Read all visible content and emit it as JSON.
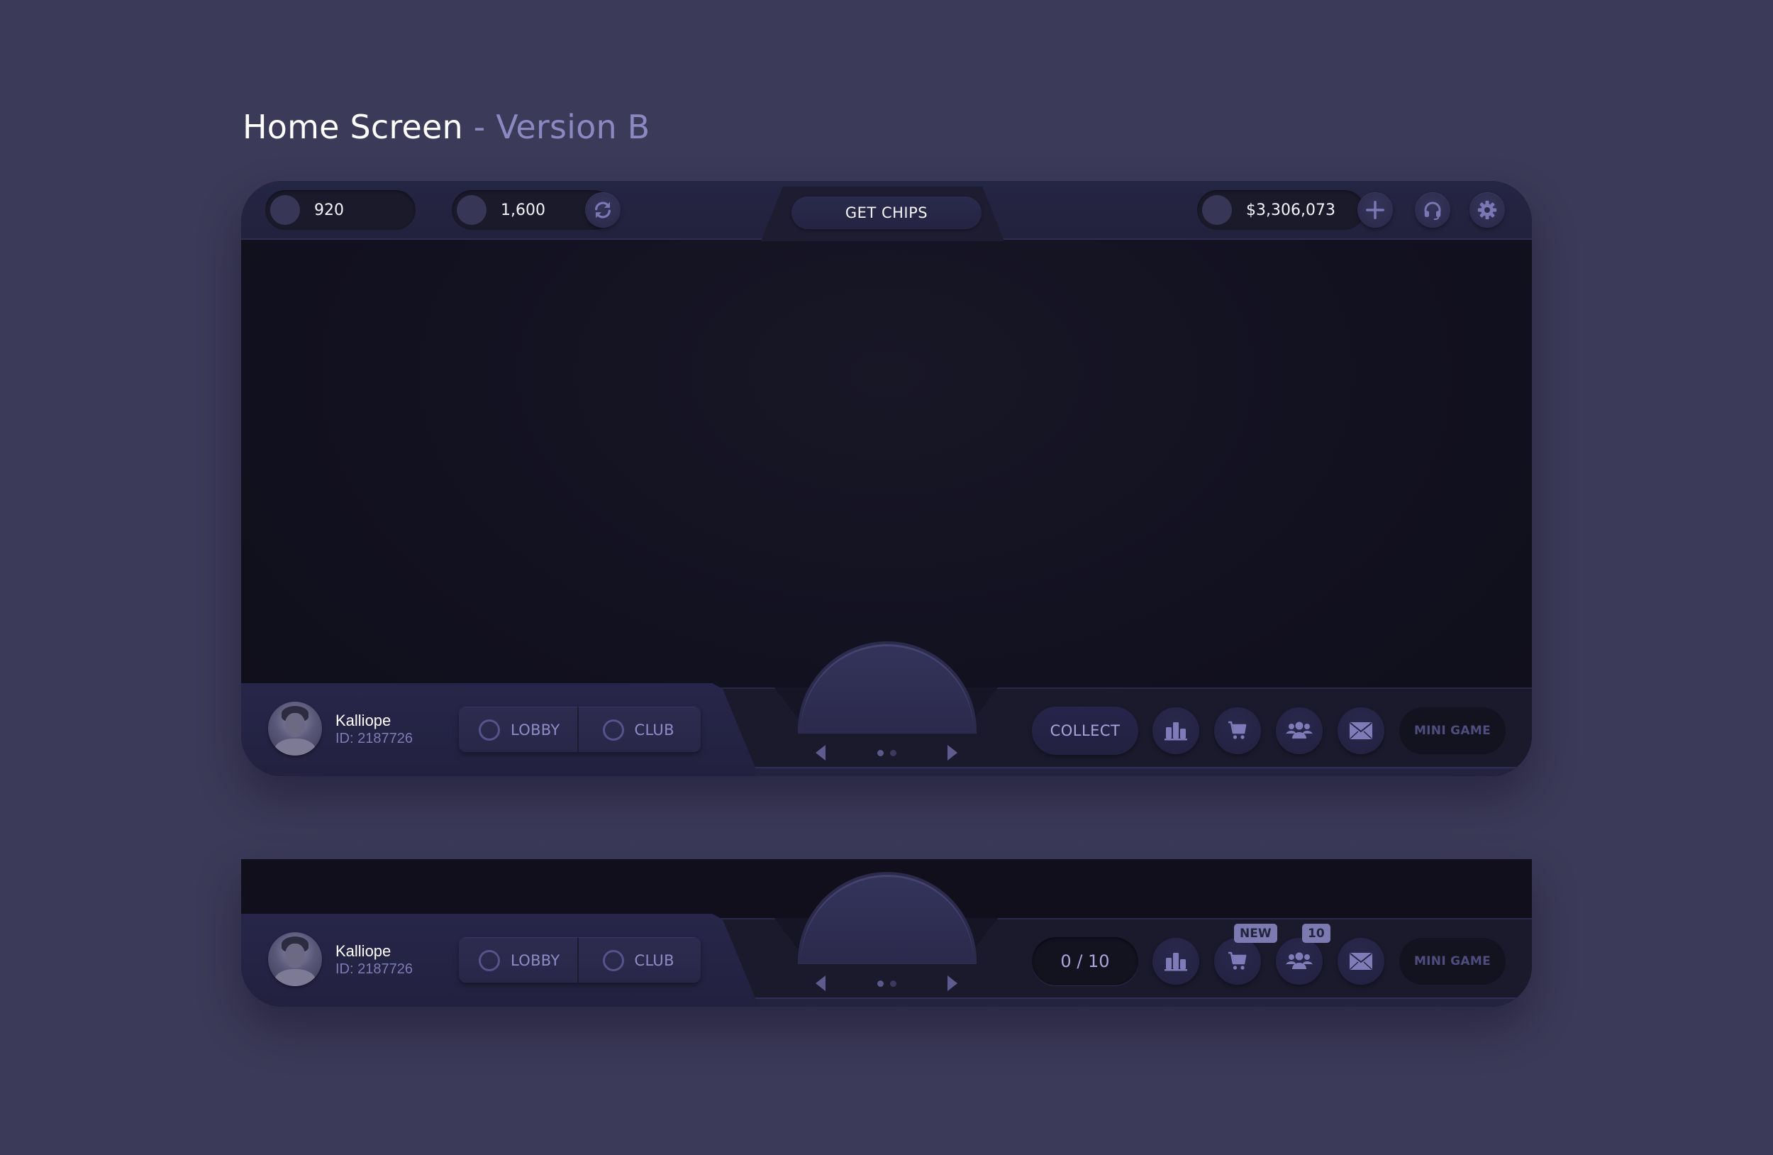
{
  "page": {
    "title": "Home Screen",
    "subtitle": "- Version B"
  },
  "colors": {
    "background": "#3b3a58",
    "panel": "#22223e",
    "accent": "#8b88c2",
    "badge": "#7d7ab2"
  },
  "topbar": {
    "currency1": {
      "icon": "coin-icon",
      "value": "920"
    },
    "currency2": {
      "icon": "coin-icon",
      "value": "1,600"
    },
    "refresh_icon": "refresh-icon",
    "get_chips_label": "GET CHIPS",
    "balance": {
      "icon": "coin-icon",
      "value": "$3,306,073"
    },
    "add_icon": "plus-icon",
    "support_icon": "headset-icon",
    "settings_icon": "gear-icon"
  },
  "main_bottombar": {
    "player": {
      "name": "Kalliope",
      "id": "ID: 2187726"
    },
    "tabs": [
      {
        "label": "LOBBY",
        "icon": "ring-icon"
      },
      {
        "label": "CLUB",
        "icon": "ring-icon"
      }
    ],
    "carousel": {
      "pages": 2,
      "active": 1
    },
    "collect_label": "COLLECT",
    "icons": [
      {
        "name": "leaderboard-icon"
      },
      {
        "name": "cart-icon"
      },
      {
        "name": "friends-icon"
      },
      {
        "name": "mail-icon"
      }
    ],
    "minigame_label": "MINI GAME"
  },
  "alt_bottombar": {
    "player": {
      "name": "Kalliope",
      "id": "ID: 2187726"
    },
    "tabs": [
      {
        "label": "LOBBY",
        "icon": "ring-icon"
      },
      {
        "label": "CLUB",
        "icon": "ring-icon"
      }
    ],
    "carousel": {
      "pages": 2,
      "active": 1
    },
    "counter": "0 / 10",
    "icons": [
      {
        "name": "leaderboard-icon"
      },
      {
        "name": "cart-icon",
        "badge": "NEW"
      },
      {
        "name": "friends-icon",
        "badge": "10"
      },
      {
        "name": "mail-icon"
      }
    ],
    "minigame_label": "MINI GAME"
  }
}
